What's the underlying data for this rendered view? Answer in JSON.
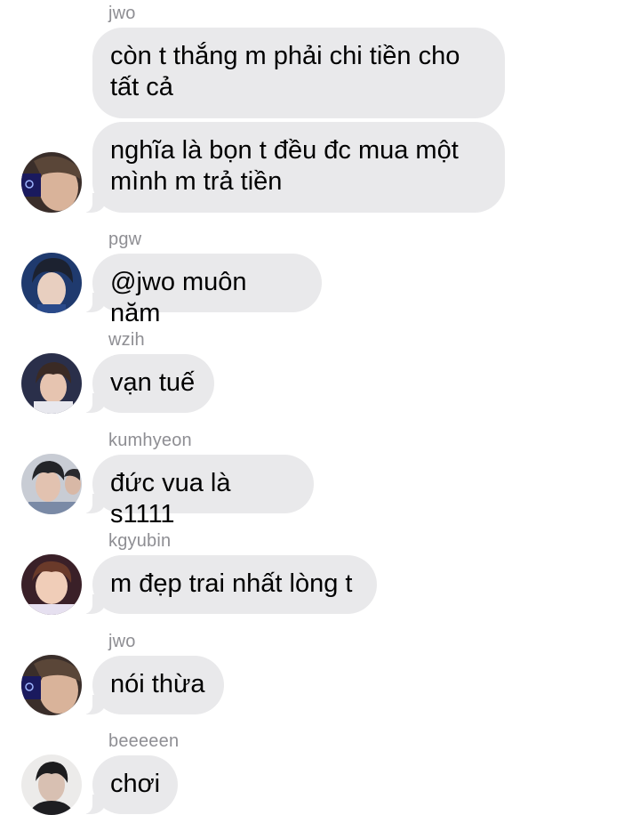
{
  "messages": [
    {
      "sender": "jwo",
      "text": "còn t thắng m phải chi tiền cho\ntất cả"
    },
    {
      "sender": "",
      "text": "nghĩa là bọn t đều đc mua một\nmình m trả tiền"
    },
    {
      "sender": "pgw",
      "text": "@jwo muôn năm"
    },
    {
      "sender": "wzih",
      "text": "vạn tuế"
    },
    {
      "sender": "kumhyeon",
      "text": "đức vua là s1111"
    },
    {
      "sender": "kgyubin",
      "text": "m đẹp trai nhất lòng t"
    },
    {
      "sender": "jwo",
      "text": "nói thừa"
    },
    {
      "sender": "beeeeen",
      "text": "chơi"
    }
  ],
  "colors": {
    "bubble": "#e9e9eb",
    "sender_text": "#8e8e93",
    "message_text": "#000000",
    "background": "#ffffff"
  },
  "avatars": [
    "avatar-jwo",
    "avatar-pgw",
    "avatar-wzih",
    "avatar-kumhyeon",
    "avatar-kgyubin",
    "avatar-jwo",
    "avatar-beeeeen"
  ]
}
